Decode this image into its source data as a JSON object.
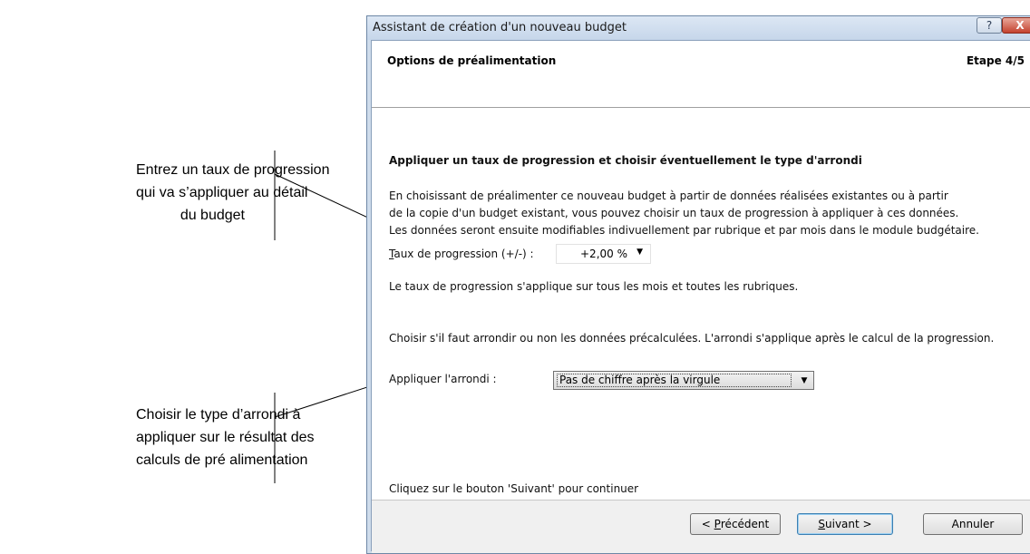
{
  "callouts": [
    {
      "lines": [
        "Entrez un taux de progression",
        "qui va s’appliquer au détail",
        "du budget"
      ]
    },
    {
      "lines": [
        "Choisir le type d’arrondi à",
        "appliquer sur le résultat des",
        "calculs de pré alimentation"
      ]
    }
  ],
  "window": {
    "title": "Assistant de création d'un nouveau budget",
    "help_icon": "question-mark-icon",
    "close_icon": "close-x-icon",
    "help_glyph": "?",
    "close_glyph": "X"
  },
  "header": {
    "title": "Options de préalimentation",
    "step": "Etape 4/5"
  },
  "content": {
    "heading": "Appliquer un taux de progression et choisir éventuellement le type d'arrondi",
    "paragraph": [
      "En choisissant de préalimenter ce nouveau budget à partir de données réalisées existantes ou à partir",
      "de la copie d'un budget existant, vous pouvez choisir un taux de progression à appliquer à ces données.",
      "Les données seront ensuite modifiables indivuellement par rubrique et par mois dans le module budgétaire."
    ],
    "rate_label_accel": "T",
    "rate_label_rest": "aux de progression (+/-) :",
    "rate_value": "+2,00 %",
    "rate_note": "Le taux de progression s'applique sur tous les mois et toutes les rubriques.",
    "rounding_intro": "Choisir s'il faut arrondir ou non les données précalculées. L'arrondi s'applique après le calcul de la progression.",
    "rounding_label": "Appliquer l'arrondi :",
    "rounding_selected": "Pas de chiffre après la virgule",
    "continue_text": "Cliquez sur le bouton 'Suivant' pour continuer"
  },
  "buttons": {
    "prev_prefix": "< ",
    "prev_accel": "P",
    "prev_rest": "récédent",
    "next_accel": "S",
    "next_rest": "uivant >",
    "cancel": "Annuler"
  }
}
